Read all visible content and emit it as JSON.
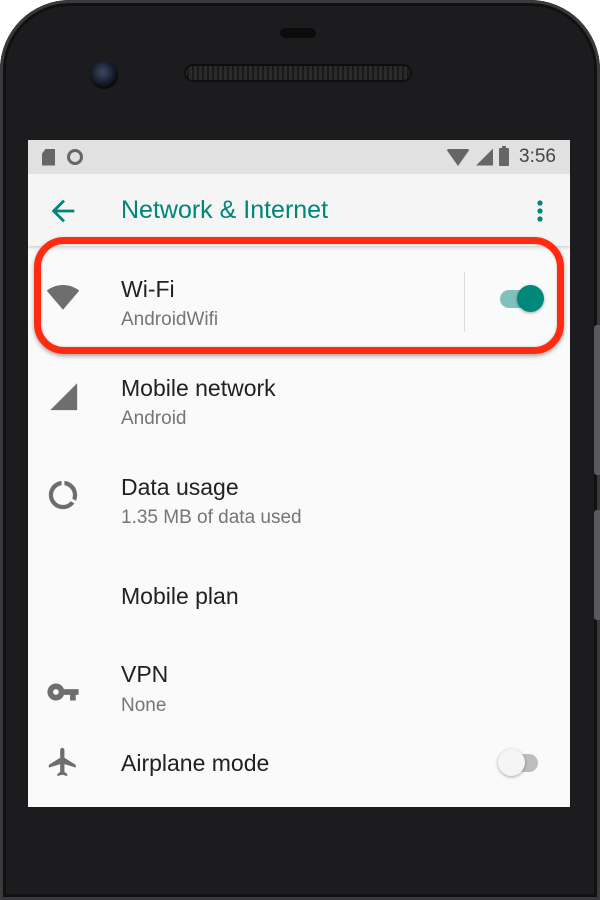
{
  "status_bar": {
    "time": "3:56"
  },
  "app_bar": {
    "title": "Network & Internet",
    "accent": "#008577"
  },
  "items": [
    {
      "label": "Wi-Fi",
      "sub": "AndroidWifi",
      "icon": "wifi-icon",
      "toggle": true
    },
    {
      "label": "Mobile network",
      "sub": "Android",
      "icon": "signal-icon"
    },
    {
      "label": "Data usage",
      "sub": "1.35 MB of data used",
      "icon": "data-usage-icon"
    },
    {
      "label": "Mobile plan",
      "icon": "none"
    },
    {
      "label": "VPN",
      "sub": "None",
      "icon": "key-icon"
    },
    {
      "label": "Airplane mode",
      "icon": "airplane-icon",
      "toggle": false
    }
  ],
  "colors": {
    "toggle_on": "#00897b",
    "highlight": "#ff2a12",
    "status_bar_bg": "#e1e1e1"
  }
}
